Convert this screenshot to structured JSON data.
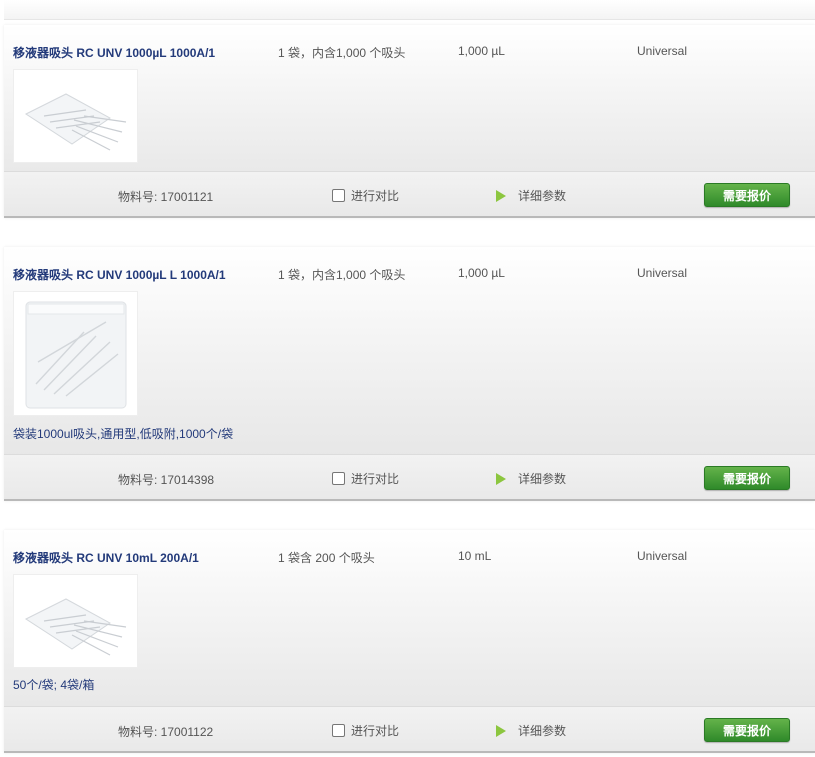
{
  "products": [
    {
      "name": "移液器吸头 RC UNV 1000µL 1000A/1",
      "pack": "1 袋，内含1,000 个吸头",
      "volume": "1,000 µL",
      "category": "Universal",
      "image_icon": "pipette-tips-loose-icon",
      "description": "",
      "material_label": "物料号: 17001121",
      "compare_label": "进行对比",
      "details_label": "详细参数",
      "quote_label": "需要报价"
    },
    {
      "name": "移液器吸头 RC UNV 1000µL L 1000A/1",
      "pack": "1 袋，内含1,000 个吸头",
      "volume": "1,000 µL",
      "category": "Universal",
      "image_icon": "pipette-tips-bag-icon",
      "description": "袋装1000ul吸头,通用型,低吸附,1000个/袋",
      "material_label": "物料号: 17014398",
      "compare_label": "进行对比",
      "details_label": "详细参数",
      "quote_label": "需要报价"
    },
    {
      "name": "移液器吸头 RC UNV 10mL 200A/1",
      "pack": "1 袋含 200 个吸头",
      "volume": "10 mL",
      "category": "Universal",
      "image_icon": "pipette-tips-loose-icon",
      "description": "50个/袋; 4袋/箱",
      "material_label": "物料号: 17001122",
      "compare_label": "进行对比",
      "details_label": "详细参数",
      "quote_label": "需要报价"
    }
  ],
  "colors": {
    "product_name": "#233a7a",
    "quote_button": "#3c9a32",
    "play_arrow": "#8cc63f"
  }
}
